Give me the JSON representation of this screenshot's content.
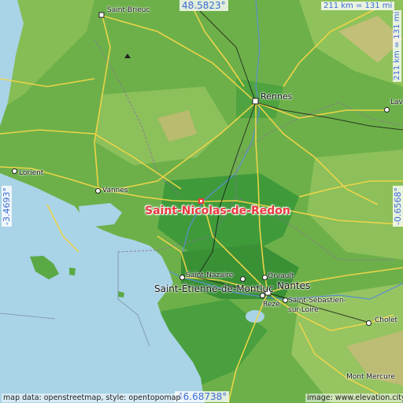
{
  "location": {
    "name": "Saint-Nicolas-de-Redon",
    "marker_color": "#e8383d"
  },
  "coordinates": {
    "top_latitude": "48.5823°",
    "bottom_latitude": "46.68738°",
    "left_longitude": "-3.4693°",
    "right_longitude": "-0.6568°"
  },
  "scale": {
    "horizontal": "211 km = 131 mi",
    "vertical": "211 km = 131 mi"
  },
  "cities": [
    {
      "id": "saint-brieuc",
      "name": "Saint-Brieuc"
    },
    {
      "id": "rennes",
      "name": "Rennes"
    },
    {
      "id": "laval",
      "name": "Lav"
    },
    {
      "id": "lorient",
      "name": "Lorient"
    },
    {
      "id": "vannes",
      "name": "Vannes"
    },
    {
      "id": "saint-nazaire",
      "name": "Saint-Nazaire"
    },
    {
      "id": "orvault",
      "name": "Orvault"
    },
    {
      "id": "nantes",
      "name": "Nantes"
    },
    {
      "id": "saint-etienne",
      "name": "Saint-Étienne-de-Montluc"
    },
    {
      "id": "reze",
      "name": "Rezé"
    },
    {
      "id": "saint-sebastien",
      "name": "Saint-Sébastien-sur-Loire"
    },
    {
      "id": "cholet",
      "name": "Cholet"
    },
    {
      "id": "mont-mercure",
      "name": "Mont Mercure"
    }
  ],
  "attribution": {
    "left": "map data: openstreetmap, style: opentopomap",
    "right": "image: www.elevation.city"
  },
  "colors": {
    "sea": "#a9d3e6",
    "lowland": "#3f9a3a",
    "midland": "#7ab64c",
    "upland": "#c7c173",
    "roads": "#f2d648",
    "coord_text": "#3c6bd6"
  }
}
